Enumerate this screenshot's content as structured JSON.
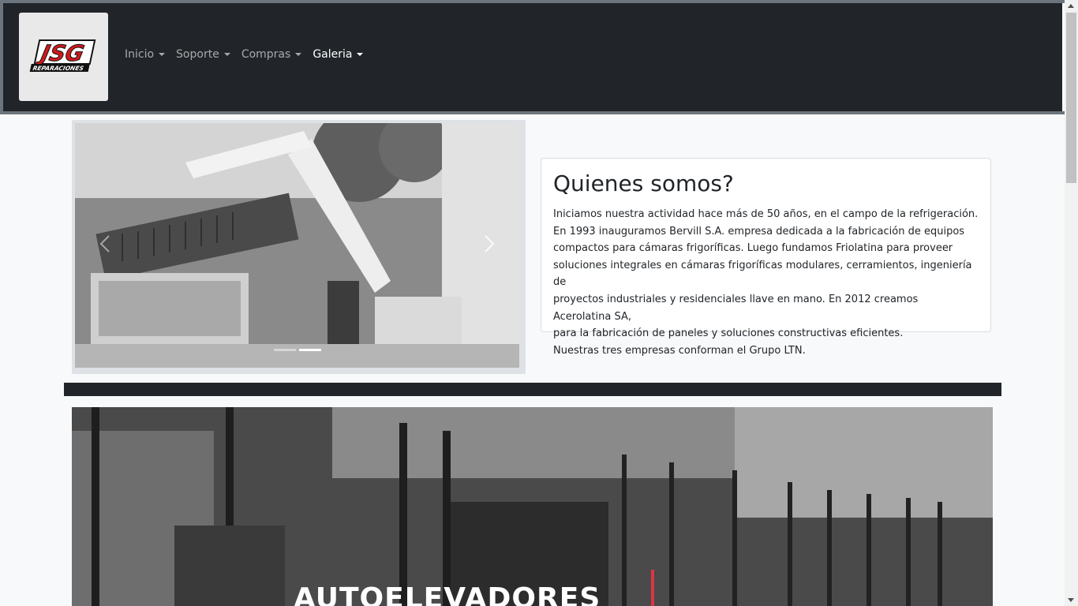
{
  "navbar": {
    "brand": {
      "logo_text": "JSG",
      "logo_subtext": "REPARACIONES"
    },
    "items": [
      {
        "label": "Inicio",
        "active": false
      },
      {
        "label": "Soporte",
        "active": false
      },
      {
        "label": "Compras",
        "active": false
      },
      {
        "label": "Galeria",
        "active": true
      }
    ]
  },
  "carousel": {
    "slide_count": 2,
    "active_slide": 2,
    "prev_icon": "chevron-left-icon",
    "next_icon": "chevron-right-icon"
  },
  "about": {
    "title": "Quienes somos?",
    "lines": [
      "Iniciamos nuestra actividad hace más de 50 años, en el campo de la refrigeración.",
      "En 1993 inauguramos Bervill S.A. empresa dedicada a la fabricación de equipos",
      "compactos para cámaras frigoríficas. Luego fundamos Friolatina para proveer",
      "soluciones integrales en cámaras frigoríficas modulares, cerramientos, ingeniería de",
      "proyectos industriales y residenciales llave en mano. En 2012 creamos Acerolatina SA,",
      "para la fabricación de paneles y soluciones constructivas eficientes.",
      "Nuestras tres empresas conforman el Grupo LTN."
    ]
  },
  "hero": {
    "title": "AUTOELEVADORES"
  },
  "colors": {
    "navbar_bg": "#212529",
    "logo_red": "#d0191b",
    "accent_red": "#dc3545"
  }
}
